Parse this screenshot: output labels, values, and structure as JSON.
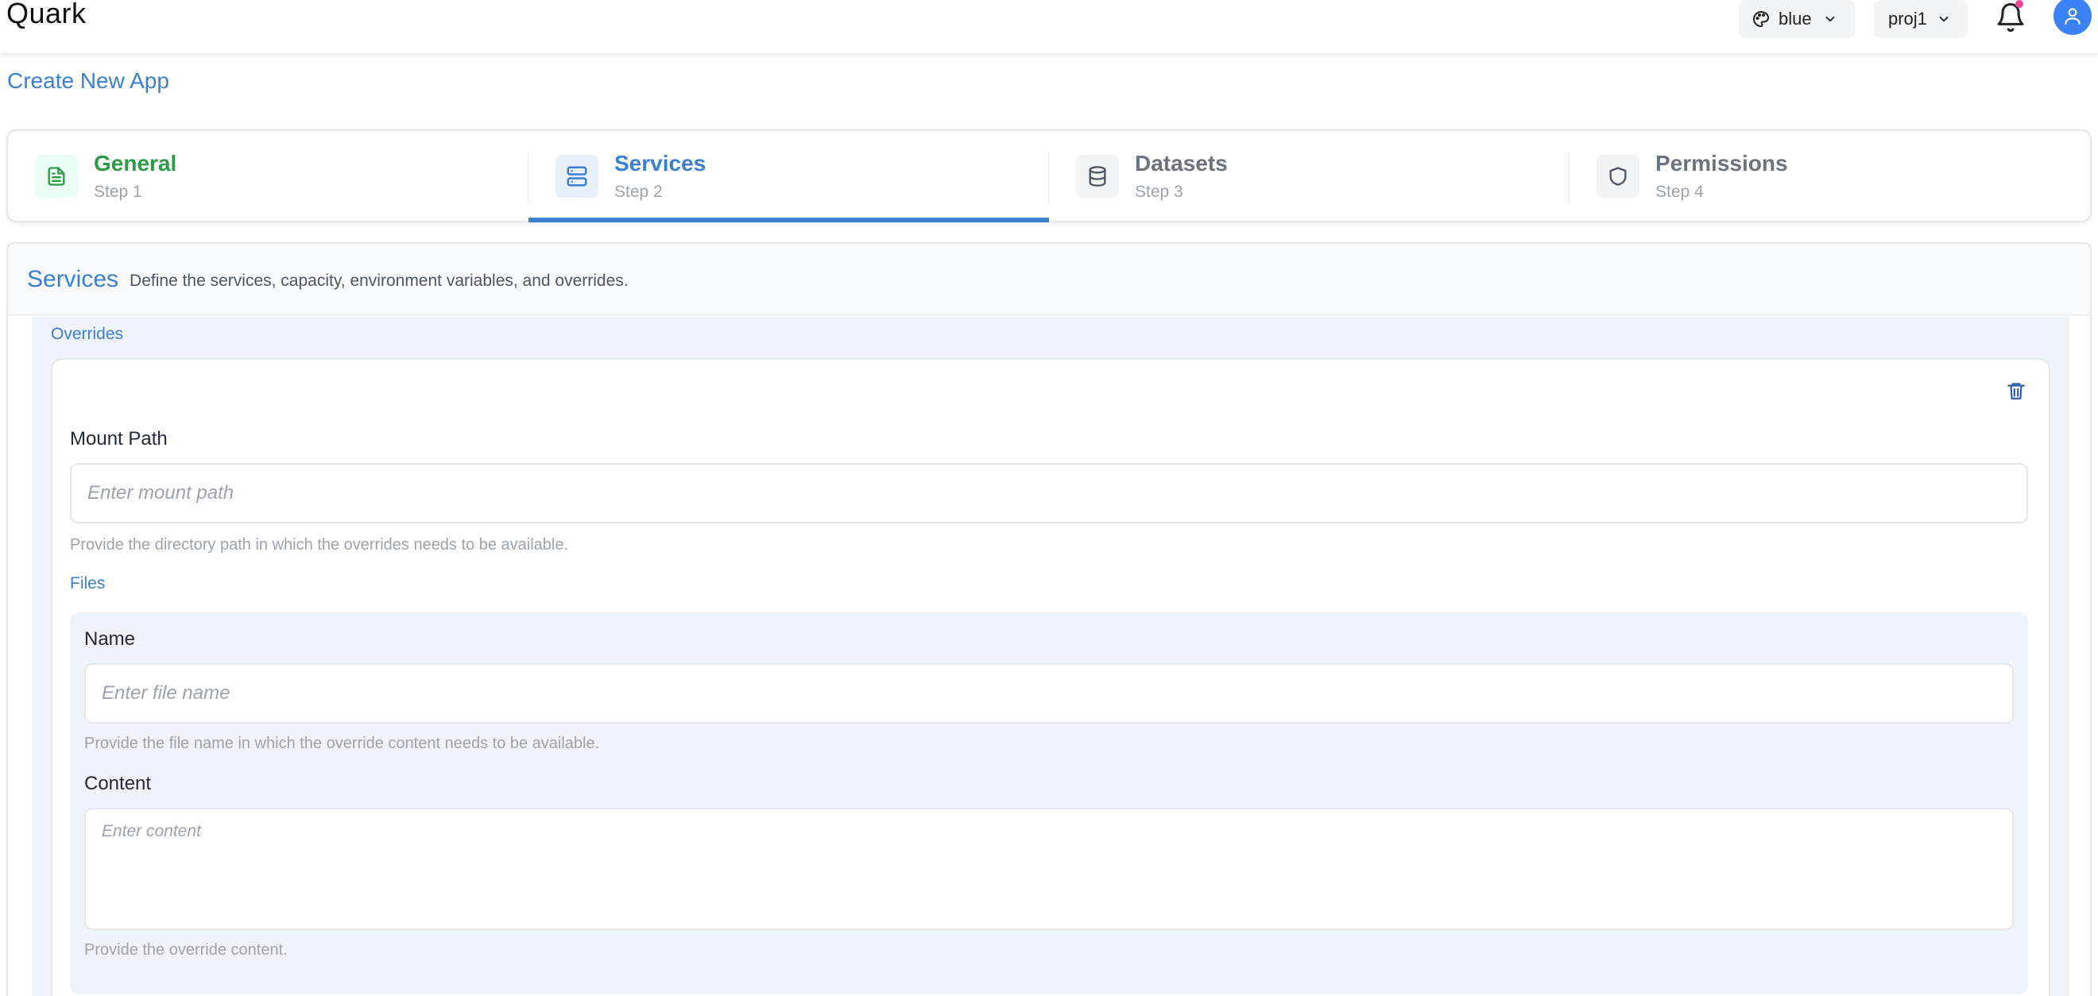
{
  "app": {
    "brand": "Quark"
  },
  "topbar": {
    "theme_label": "blue",
    "project_label": "proj1"
  },
  "page": {
    "title": "Create New App"
  },
  "stepper": {
    "steps": [
      {
        "title": "General",
        "sub": "Step 1",
        "state": "done"
      },
      {
        "title": "Services",
        "sub": "Step 2",
        "state": "active"
      },
      {
        "title": "Datasets",
        "sub": "Step 3",
        "state": "pending"
      },
      {
        "title": "Permissions",
        "sub": "Step 4",
        "state": "pending"
      }
    ]
  },
  "services": {
    "title": "Services",
    "description": "Define the services, capacity, environment variables, and overrides.",
    "overrides": {
      "label": "Overrides",
      "mount_path": {
        "label": "Mount Path",
        "placeholder": "Enter mount path",
        "value": "",
        "help": "Provide the directory path in which the overrides needs to be available."
      },
      "files_label": "Files",
      "file": {
        "name_label": "Name",
        "name_placeholder": "Enter file name",
        "name_help": "Provide the file name in which the override content needs to be available.",
        "content_label": "Content",
        "content_placeholder": "Enter content",
        "content_help": "Provide the override content."
      }
    }
  },
  "colors": {
    "accent": "#3b7fd1",
    "success": "#2e9a48",
    "notification_dot": "#ec4899",
    "avatar": "#3b82f6"
  },
  "icons": [
    "palette-icon",
    "chevron-down-icon",
    "bell-icon",
    "user-icon",
    "document-icon",
    "server-icon",
    "database-icon",
    "shield-icon",
    "trash-icon"
  ]
}
